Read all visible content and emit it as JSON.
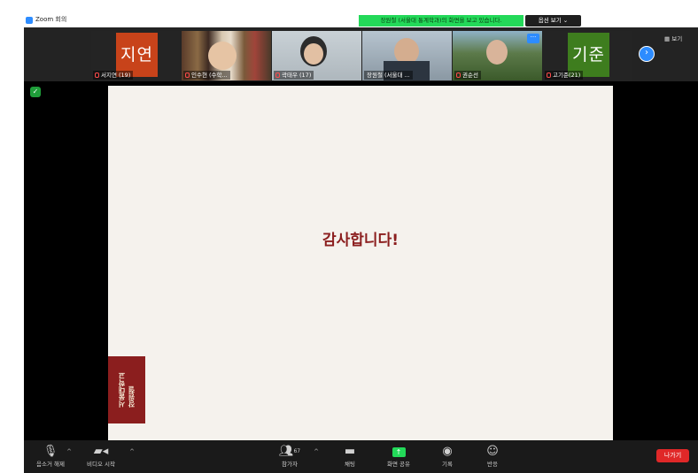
{
  "window": {
    "title": "Zoom 회의"
  },
  "share_banner": {
    "text": "장원철 (서울대 통계학과)의 화면을 보고 있습니다.",
    "view_options": "옵션 보기 ⌄"
  },
  "participants": [
    {
      "name": "서지연 (19)",
      "avatar_text": "지연",
      "avatar_color": "#C8431A"
    },
    {
      "name": "인수현 (수학..."
    },
    {
      "name": "곽태우 (17)"
    },
    {
      "name": "장원철 (서울대 ..."
    },
    {
      "name": "권순선"
    },
    {
      "name": "고기준(21)",
      "avatar_text": "기준",
      "avatar_color": "#3E7D1E"
    }
  ],
  "strip": {
    "view_toggle": "▦ 보기",
    "next_icon": "chevron-right-icon"
  },
  "slide": {
    "title": "감사합니다!",
    "seal_line1": "서울대학교",
    "seal_line2": "장원철"
  },
  "toolbar": {
    "mute_label": "음소거 해제",
    "video_label": "비디오 시작",
    "participants_label": "참가자",
    "participants_count": "67",
    "chat_label": "채팅",
    "share_label": "화면 공유",
    "record_label": "기록",
    "reactions_label": "반응",
    "leave_label": "나가기"
  },
  "colors": {
    "accent": "#2D8CFF",
    "share_green": "#23D959",
    "leave_red": "#E02828",
    "slide_text": "#8B1E1E"
  }
}
